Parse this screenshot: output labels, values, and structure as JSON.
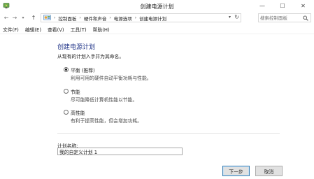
{
  "window": {
    "title": "创建电源计划",
    "min_glyph": "—",
    "max_glyph": "☐",
    "close_glyph": "✕"
  },
  "address_bar": {
    "back_glyph": "←",
    "forward_glyph": "→",
    "history_glyph": "▾",
    "up_glyph": "↑",
    "breadcrumb": [
      "控制面板",
      "硬件和声音",
      "电源选项",
      "创建电源计划"
    ],
    "separator": "›",
    "dropdown_glyph": "▾",
    "refresh_glyph": "↻",
    "search_placeholder": "搜索控制面板"
  },
  "menubar": {
    "items": [
      "文件(F)",
      "编辑(E)",
      "查看(V)",
      "工具(T)",
      "帮助(H)"
    ]
  },
  "main": {
    "heading": "创建电源计划",
    "subtitle": "从现有的计划入手并为其命名。",
    "options": [
      {
        "label": "平衡 (推荐)",
        "description": "利用可用的硬件自动平衡功耗与性能。",
        "checked": true
      },
      {
        "label": "节能",
        "description": "尽可能降低计算机性能以节能。",
        "checked": false
      },
      {
        "label": "高性能",
        "description": "有利于提高性能，但会增加功耗。",
        "checked": false
      }
    ],
    "plan_name_label": "计划名称:",
    "plan_name_value": "我的自定义计划 1"
  },
  "buttons": {
    "next": "下一步",
    "cancel": "取消"
  },
  "colors": {
    "heading": "#1e3287",
    "window_bg": "#ffffff",
    "button_bg": "#e1e1e1",
    "default_button_border": "#3c7fb1"
  },
  "icons": [
    "power-options-icon",
    "control-panel-icon",
    "search-icon"
  ]
}
